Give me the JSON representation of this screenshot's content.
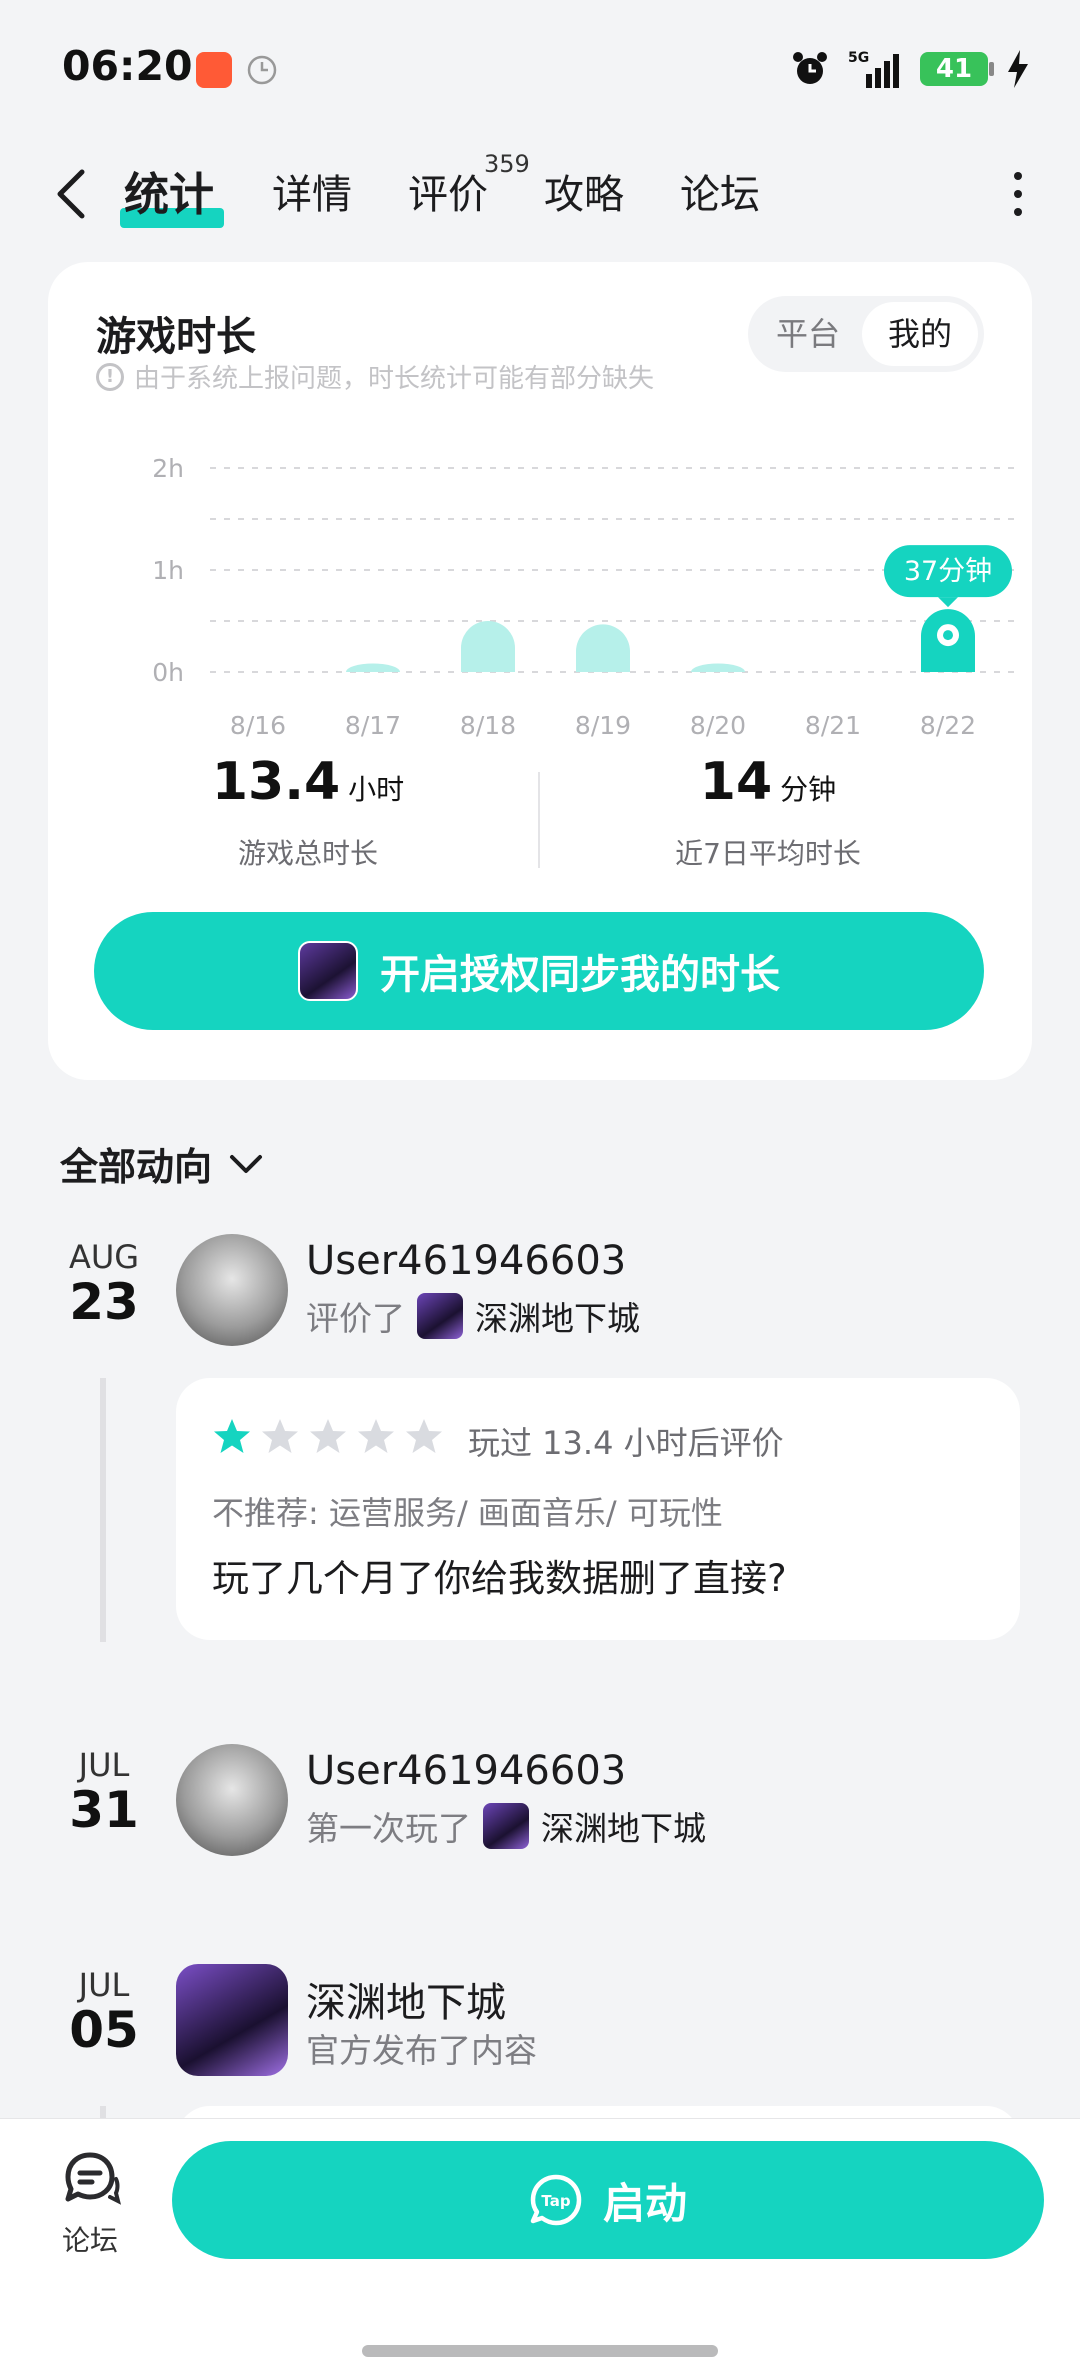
{
  "status_bar": {
    "time": "06:20",
    "network": "5G",
    "battery": "41"
  },
  "nav": {
    "tabs": [
      {
        "label": "统计",
        "active": true
      },
      {
        "label": "详情"
      },
      {
        "label": "评价",
        "badge": "359"
      },
      {
        "label": "攻略"
      },
      {
        "label": "论坛"
      }
    ]
  },
  "stats_card": {
    "title": "游戏时长",
    "note": "由于系统上报问题，时长统计可能有部分缺失",
    "toggle": {
      "platform": "平台",
      "mine": "我的",
      "selected": "mine"
    },
    "total": {
      "value": "13.4",
      "unit": "小时",
      "label": "游戏总时长"
    },
    "average": {
      "value": "14",
      "unit": "分钟",
      "label": "近7日平均时长"
    },
    "sync_button": "开启授权同步我的时长"
  },
  "chart_data": {
    "type": "bar",
    "categories": [
      "8/16",
      "8/17",
      "8/18",
      "8/19",
      "8/20",
      "8/21",
      "8/22"
    ],
    "values_minutes": [
      0,
      5,
      30,
      28,
      5,
      0,
      37
    ],
    "y_ticks": [
      "0h",
      "1h",
      "2h"
    ],
    "ylim_minutes": [
      0,
      120
    ],
    "highlight": {
      "category": "8/22",
      "label": "37分钟"
    },
    "grid": true,
    "colors": {
      "bar": "#b6f0ea",
      "highlight": "#15d4c0"
    }
  },
  "feed": {
    "filter_label": "全部动向",
    "items": [
      {
        "month": "AUG",
        "day": "23",
        "name": "User461946603",
        "action": "评价了",
        "game": "深渊地下城",
        "review": {
          "rating": 1,
          "max_rating": 5,
          "meta": "玩过 13.4 小时后评价",
          "tags": "不推荐: 运营服务/ 画面音乐/ 可玩性",
          "text": "玩了几个月了你给我数据删了直接?"
        }
      },
      {
        "month": "JUL",
        "day": "31",
        "name": "User461946603",
        "action": "第一次玩了",
        "game": "深渊地下城"
      },
      {
        "month": "JUL",
        "day": "05",
        "name": "深渊地下城",
        "action": "官方发布了内容"
      }
    ]
  },
  "bottom_bar": {
    "forum_label": "论坛",
    "launch_label": "启动",
    "accent": "#15d4c0"
  }
}
